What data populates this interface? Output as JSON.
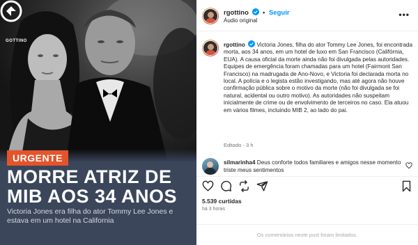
{
  "media": {
    "logo_text": "GOTTINO",
    "badge": "URGENTE",
    "headline": "MORRE ATRIZ DE MIB AOS 34 ANOS",
    "subhead": "Victoria Jones era filha do ator Tommy Lee Jones e estava em um hotel na California"
  },
  "header": {
    "username": "rgottino",
    "separator": "•",
    "follow_label": "Seguir",
    "audio_label": "Áudio original",
    "more_label": "•••"
  },
  "caption": {
    "username": "rgottino",
    "text": "Victoria Jones, filha do ator Tommy Lee Jones, foi encontrada morta, aos 34 anos, em um hotel de luxo em San Francisco (Califórnia, EUA). A causa oficial da morte ainda não foi divulgada pelas autoridades. Equipes de emergência foram chamadas para um hotel (Fairmont San Francisco) na madrugada de Ano-Novo, e Victoria foi declarada morta no local. A polícia e o legista estão investigando, mas até agora não houve confirmação pública sobre o motivo da morte (não foi divulgada se foi natural, acidental ou outro motivo). As autoridades não suspeitam inicialmente de crime ou de envolvimento de terceiros no caso. Ela atuou em vários filmes, incluindo MIB 2, ao lado do pai.",
    "timestamp": "Editado · 3 h"
  },
  "comment": {
    "username": "silmarinha4",
    "text": "Deus conforte todos familiares e amigos nesse momento triste meus sentimentos"
  },
  "stats": {
    "likes": "5.539 curtidas",
    "ago": "há 3 horas"
  },
  "footer": {
    "limited_text": "Os comentários neste post foram limitados."
  },
  "colors": {
    "accent": "#0095f6",
    "badge": "#e4542a",
    "panel_bg": "#3b465b"
  }
}
